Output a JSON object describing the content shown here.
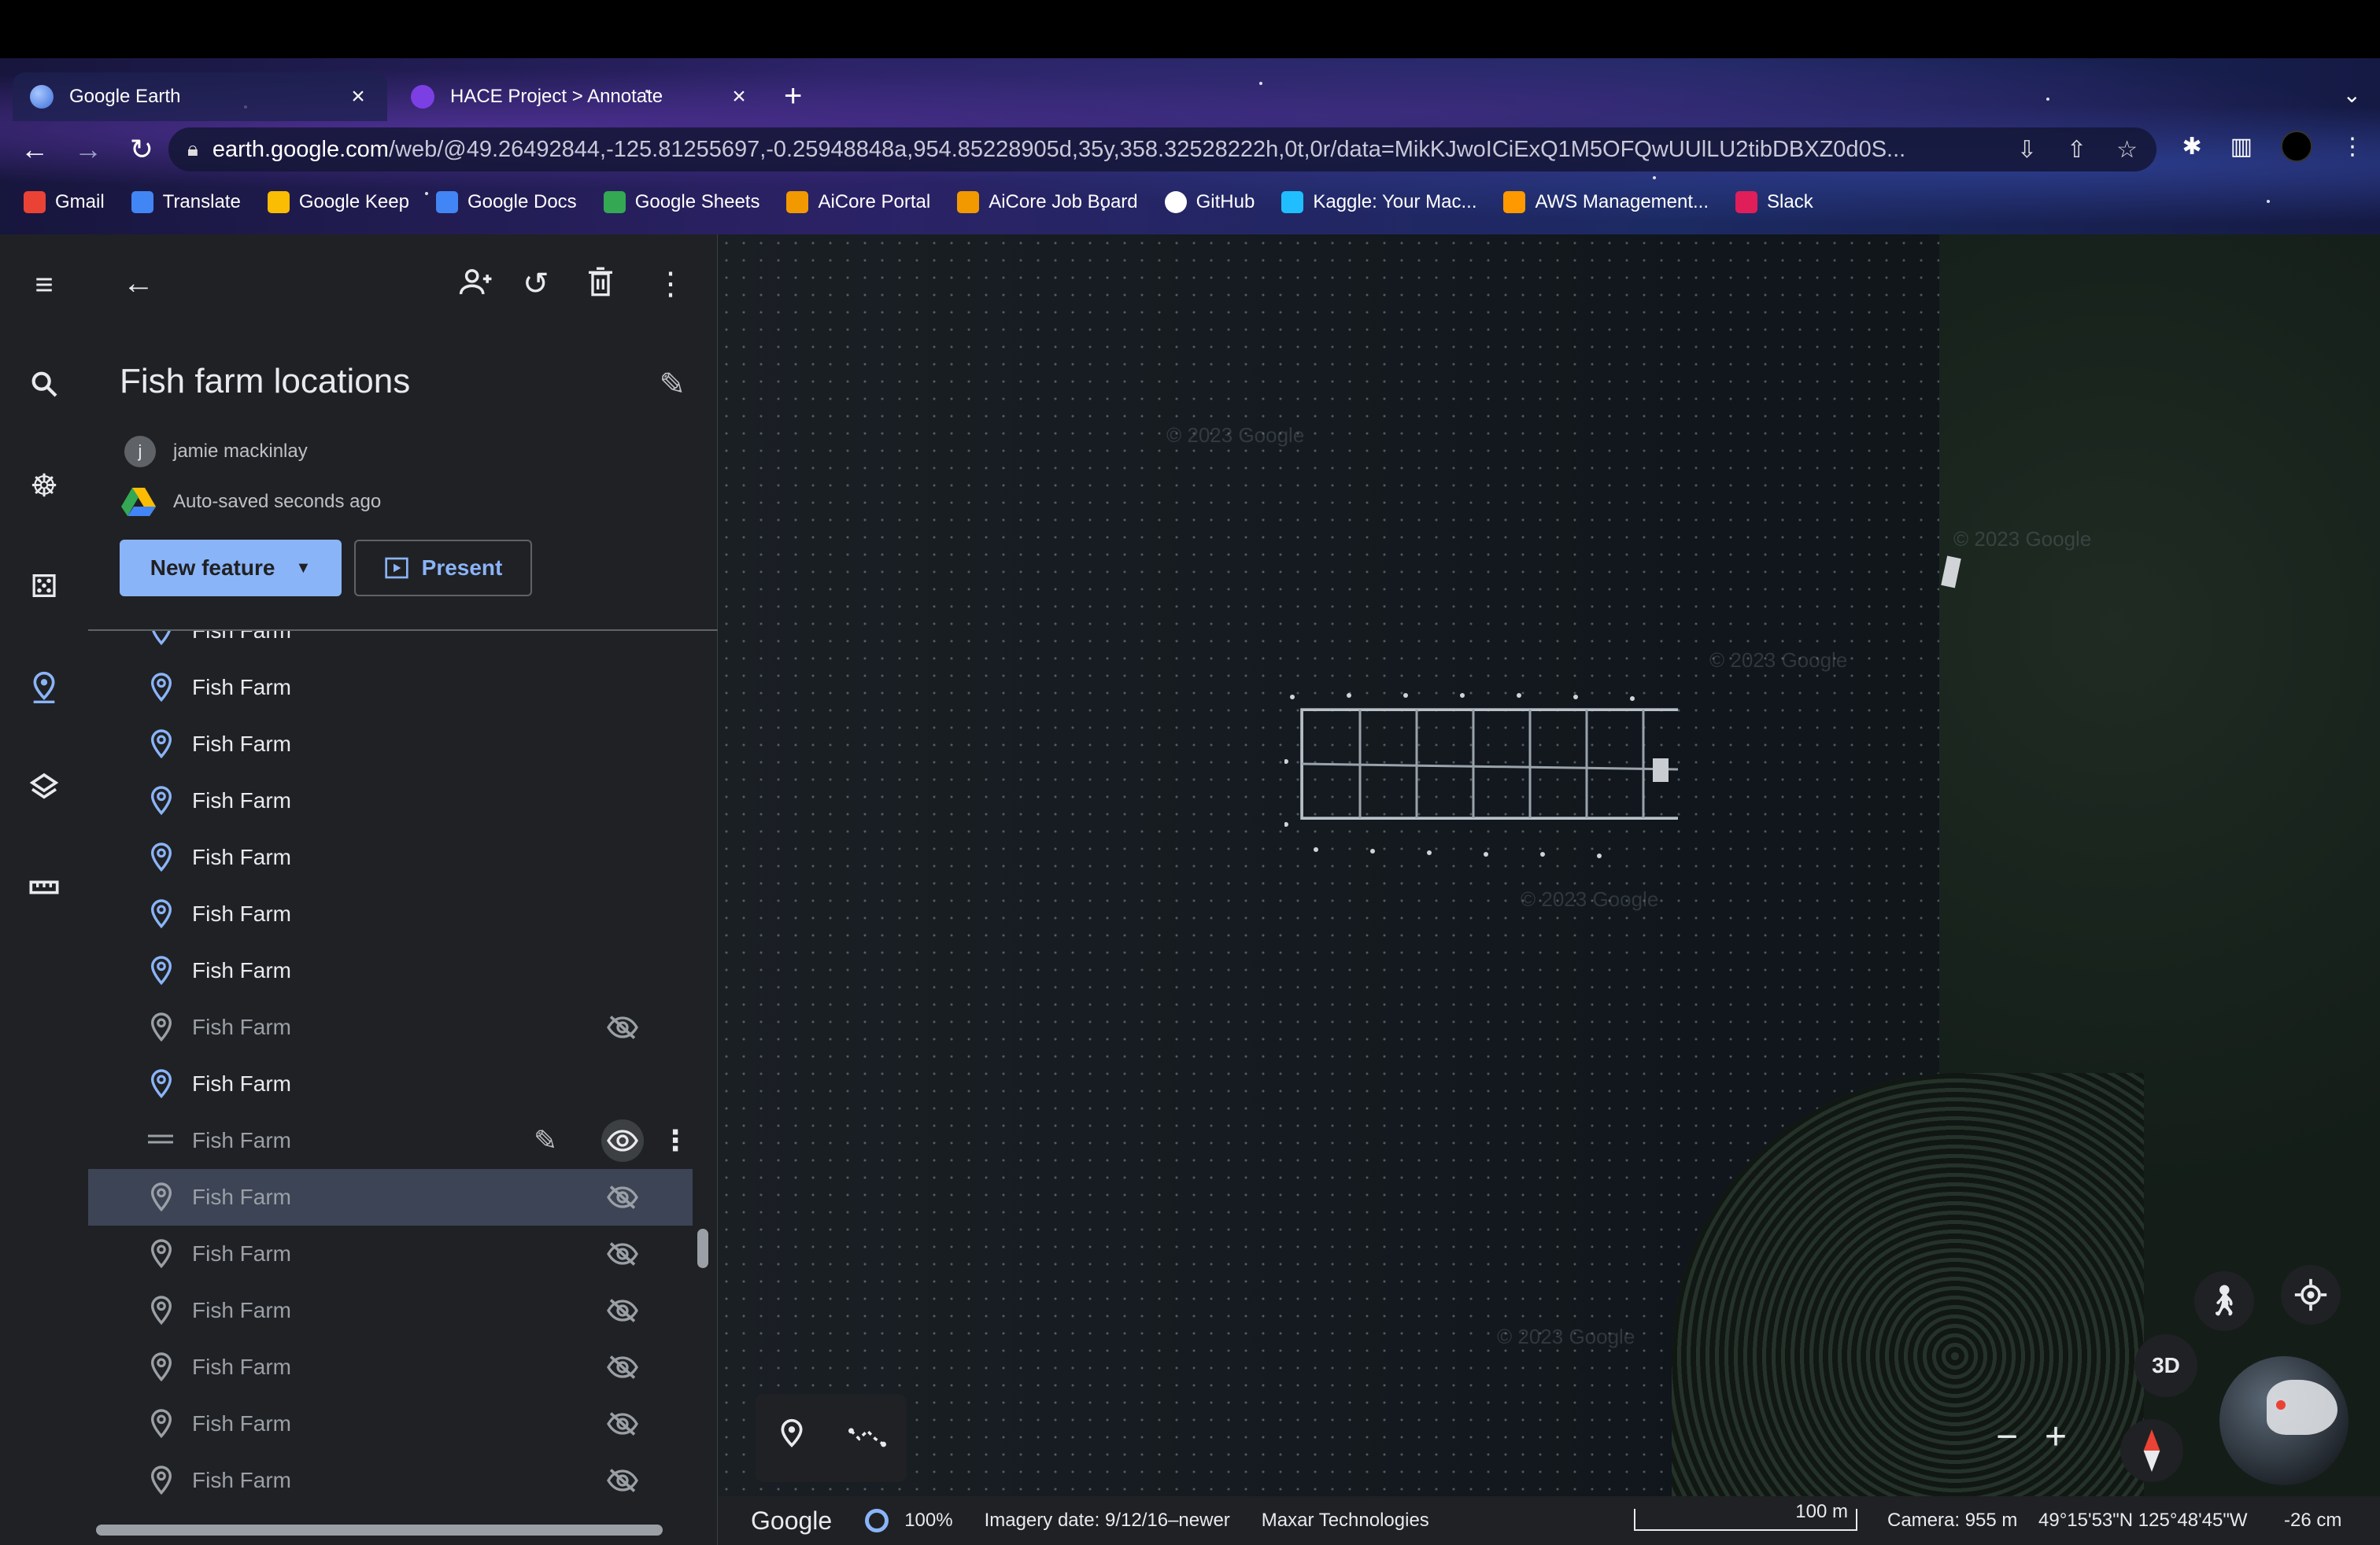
{
  "browser": {
    "tabs": [
      {
        "title": "Google Earth",
        "active": true
      },
      {
        "title": "HACE Project > Annotate",
        "active": false
      }
    ],
    "url_host": "earth.google.com",
    "url_path": "/web/@49.26492844,-125.81255697,-0.25948848a,954.85228905d,35y,358.32528222h,0t,0r/data=MikKJwoICiExQ1M5OFQwUUlLU2tibDBXZ0d0S...",
    "bookmarks": [
      "Gmail",
      "Translate",
      "Google Keep",
      "Google Docs",
      "Google Sheets",
      "AiCore Portal",
      "AiCore Job Board",
      "GitHub",
      "Kaggle: Your Mac...",
      "AWS Management...",
      "Slack"
    ]
  },
  "panel": {
    "title": "Fish farm locations",
    "owner_initial": "j",
    "owner_name": "jamie mackinlay",
    "save_status": "Auto-saved seconds ago",
    "new_feature_label": "New feature",
    "present_label": "Present",
    "items": [
      {
        "label": "Fish Farm",
        "hidden": false
      },
      {
        "label": "Fish Farm",
        "hidden": false
      },
      {
        "label": "Fish Farm",
        "hidden": false
      },
      {
        "label": "Fish Farm",
        "hidden": false
      },
      {
        "label": "Fish Farm",
        "hidden": false
      },
      {
        "label": "Fish Farm",
        "hidden": false
      },
      {
        "label": "Fish Farm",
        "hidden": false
      },
      {
        "label": "Fish Farm",
        "hidden": true
      },
      {
        "label": "Fish Farm",
        "hidden": false
      },
      {
        "label": "Fish Farm",
        "hidden": false,
        "hover": true
      },
      {
        "label": "Fish Farm",
        "hidden": true,
        "selected": true
      },
      {
        "label": "Fish Farm",
        "hidden": true
      },
      {
        "label": "Fish Farm",
        "hidden": true
      },
      {
        "label": "Fish Farm",
        "hidden": true
      },
      {
        "label": "Fish Farm",
        "hidden": true
      },
      {
        "label": "Fish Farm",
        "hidden": true
      }
    ]
  },
  "map": {
    "btn_3d": "3D",
    "watermark": "© 2023 Google",
    "status": {
      "logo": "Google",
      "load": "100%",
      "imagery": "Imagery date: 9/12/16–newer",
      "provider": "Maxar Technologies",
      "scale": "100 m",
      "camera": "Camera: 955 m",
      "coords": "49°15'53\"N 125°48'45\"W",
      "elevation": "-26 cm"
    }
  },
  "colors": {
    "accent": "#8ab4f8",
    "panel_bg": "#202124",
    "selected_row": "#3c4455"
  }
}
